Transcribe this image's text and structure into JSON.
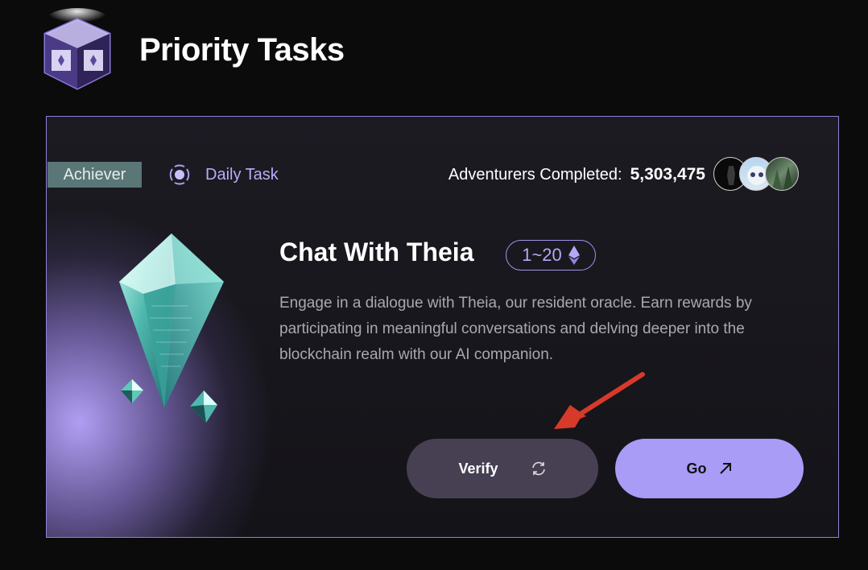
{
  "header": {
    "title": "Priority Tasks",
    "logo_icon": "cube-logo-icon"
  },
  "task": {
    "category_tag": "Achiever",
    "frequency": "Daily Task",
    "frequency_icon": "radar-dot-icon",
    "adventurers_label": "Adventurers Completed:",
    "adventurers_count": "5,303,475",
    "title": "Chat With Theia",
    "reward_range": "1~20",
    "reward_icon": "ethereum-icon",
    "description": "Engage in a dialogue with Theia, our resident oracle. Earn rewards by participating in meaningful conversations and delving deeper into the blockchain realm with our AI companion.",
    "verify_label": "Verify",
    "verify_icon": "refresh-icon",
    "go_label": "Go",
    "go_icon": "arrow-up-right-icon"
  },
  "colors": {
    "background": "#0b0b0c",
    "accent": "#a99cf7",
    "tag_bg": "#5a7677",
    "verify_bg": "#474052",
    "annotation_arrow": "#d63a2a"
  }
}
